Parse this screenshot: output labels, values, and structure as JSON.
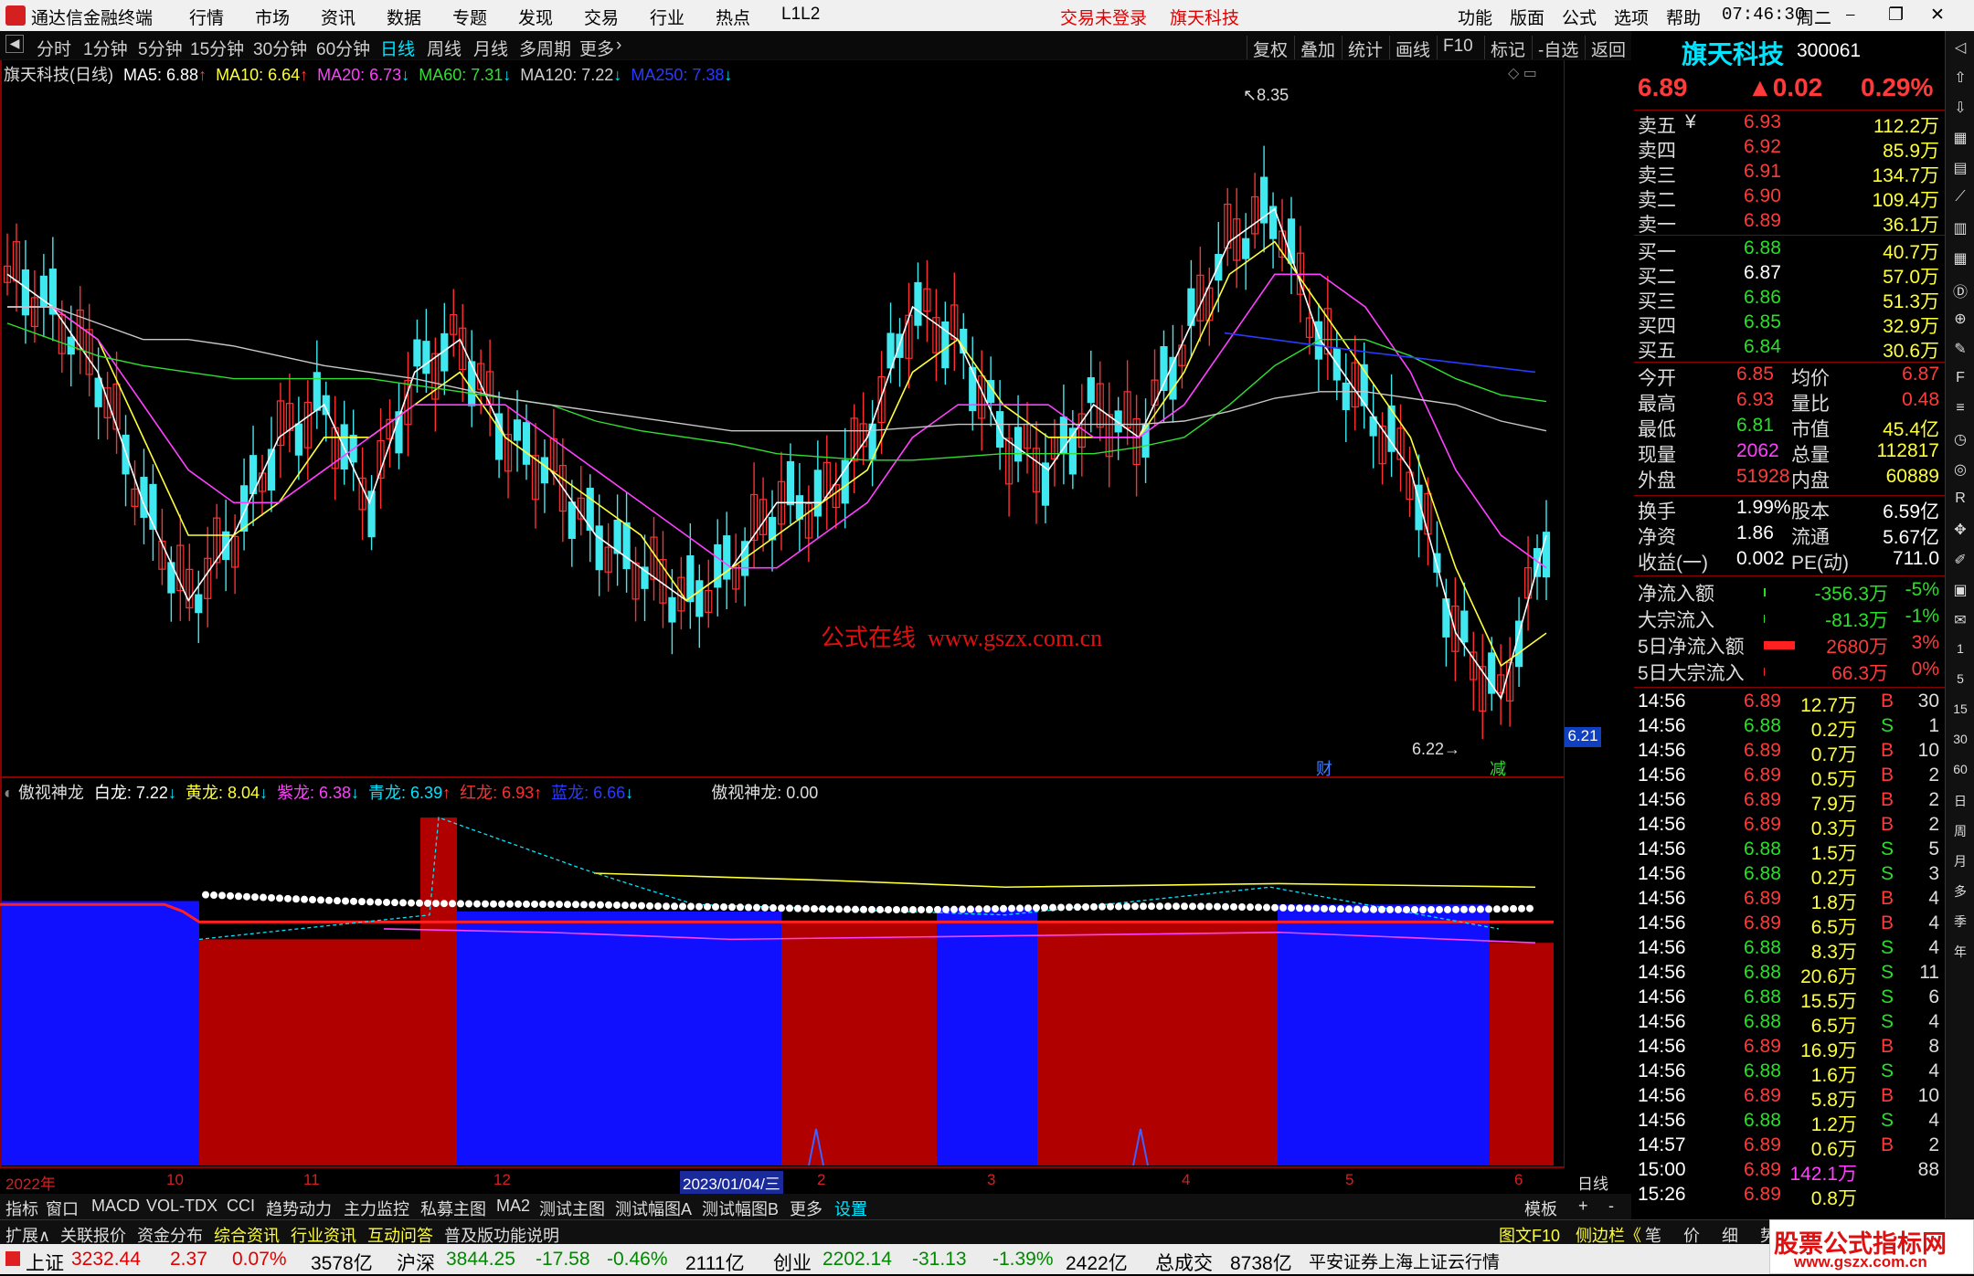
{
  "menu": {
    "app_title": "通达信金融终端",
    "items": [
      "行情",
      "市场",
      "资讯",
      "数据",
      "专题",
      "发现",
      "交易",
      "行业",
      "热点",
      "L1L2"
    ],
    "center_status": "交易未登录",
    "center_stock": "旗天科技",
    "right_items": [
      "功能",
      "版面",
      "公式",
      "选项",
      "帮助"
    ],
    "clock": "07:46:30",
    "weekday": "周二"
  },
  "periods": {
    "items": [
      "分时",
      "1分钟",
      "5分钟",
      "15分钟",
      "30分钟",
      "60分钟",
      "日线",
      "周线",
      "月线",
      "多周期",
      "更多"
    ],
    "active": "日线",
    "tools": [
      "复权",
      "叠加",
      "统计",
      "画线",
      "F10",
      "标记",
      "-自选",
      "返回"
    ]
  },
  "main_chart": {
    "title": "旗天科技(日线)",
    "ma": [
      {
        "label": "MA5: 6.88",
        "arrow": "↑",
        "color": "#ffffff"
      },
      {
        "label": "MA10: 6.64",
        "arrow": "↑",
        "color": "#ffff3a"
      },
      {
        "label": "MA20: 6.73",
        "arrow": "↓",
        "color": "#ff40ff"
      },
      {
        "label": "MA60: 7.31",
        "arrow": "↓",
        "color": "#30e030"
      },
      {
        "label": "MA120: 7.22",
        "arrow": "↓",
        "color": "#d0d0d0"
      },
      {
        "label": "MA250: 7.38",
        "arrow": "↓",
        "color": "#2a3aff"
      }
    ],
    "high_marker": "8.35",
    "low_marker": "6.22",
    "watermark": "公式在线  www.gszx.com.cn",
    "price_tag": "6.21",
    "event_tags": [
      "财",
      "减"
    ]
  },
  "sub_chart": {
    "title": "傲视神龙",
    "lines": [
      {
        "label": "白龙: 7.22",
        "arrow": "↓",
        "color": "#ffffff"
      },
      {
        "label": "黄龙: 8.04",
        "arrow": "↓",
        "color": "#ffff3a"
      },
      {
        "label": "紫龙: 6.38",
        "arrow": "↓",
        "color": "#ff40ff"
      },
      {
        "label": "青龙: 6.39",
        "arrow": "↑",
        "color": "#00e5ff"
      },
      {
        "label": "红龙: 6.93",
        "arrow": "↑",
        "color": "#ff3030"
      },
      {
        "label": "蓝龙: 6.66",
        "arrow": "↓",
        "color": "#2a3aff"
      }
    ],
    "extra": "傲视神龙: 0.00"
  },
  "chart_data": [
    {
      "type": "line",
      "title": "旗天科技(日线)",
      "ylim": [
        6.2,
        8.3
      ],
      "y_ticks": [
        "8.20",
        "8.00",
        "7.80",
        "7.60",
        "7.40",
        "7.20",
        "7.00",
        "6.80",
        "6.60",
        "6.40",
        "6.20"
      ],
      "x_labels": [
        "2022年",
        "10",
        "11",
        "12",
        "2023/01/04/三",
        "2",
        "3",
        "4",
        "5",
        "6",
        "日线"
      ],
      "series": [
        {
          "name": "MA5",
          "values": [
            7.7,
            7.6,
            7.4,
            7.0,
            6.7,
            6.9,
            7.2,
            7.3,
            7.0,
            7.4,
            7.5,
            7.2,
            7.1,
            6.9,
            6.8,
            6.7,
            6.8,
            7.0,
            7.0,
            7.2,
            7.6,
            7.5,
            7.2,
            7.1,
            7.3,
            7.2,
            7.5,
            7.8,
            7.9,
            7.5,
            7.3,
            7.1,
            6.6,
            6.4,
            6.9
          ]
        },
        {
          "name": "MA10",
          "values": [
            7.6,
            7.6,
            7.5,
            7.2,
            6.9,
            6.9,
            7.0,
            7.2,
            7.2,
            7.3,
            7.4,
            7.2,
            7.1,
            7.0,
            6.9,
            6.7,
            6.8,
            6.9,
            7.0,
            7.1,
            7.4,
            7.5,
            7.3,
            7.2,
            7.2,
            7.2,
            7.4,
            7.7,
            7.8,
            7.6,
            7.4,
            7.2,
            6.8,
            6.5,
            6.6
          ]
        },
        {
          "name": "MA20",
          "values": [
            7.6,
            7.6,
            7.5,
            7.3,
            7.1,
            7.0,
            7.0,
            7.1,
            7.2,
            7.3,
            7.3,
            7.3,
            7.2,
            7.1,
            7.0,
            6.9,
            6.8,
            6.8,
            6.9,
            7.0,
            7.2,
            7.3,
            7.3,
            7.3,
            7.2,
            7.2,
            7.3,
            7.5,
            7.7,
            7.7,
            7.6,
            7.4,
            7.1,
            6.9,
            6.8
          ]
        },
        {
          "name": "MA60",
          "values": [
            7.55,
            7.5,
            7.45,
            7.42,
            7.4,
            7.38,
            7.38,
            7.38,
            7.38,
            7.36,
            7.34,
            7.32,
            7.3,
            7.25,
            7.22,
            7.2,
            7.18,
            7.15,
            7.14,
            7.13,
            7.13,
            7.14,
            7.15,
            7.15,
            7.15,
            7.17,
            7.2,
            7.3,
            7.42,
            7.5,
            7.5,
            7.45,
            7.38,
            7.33,
            7.31
          ]
        },
        {
          "name": "MA120",
          "values": [
            7.6,
            7.6,
            7.55,
            7.5,
            7.5,
            7.48,
            7.45,
            7.42,
            7.4,
            7.38,
            7.35,
            7.32,
            7.3,
            7.28,
            7.26,
            7.24,
            7.22,
            7.22,
            7.22,
            7.22,
            7.23,
            7.24,
            7.24,
            7.24,
            7.24,
            7.24,
            7.25,
            7.28,
            7.32,
            7.34,
            7.34,
            7.32,
            7.3,
            7.25,
            7.22
          ]
        }
      ]
    },
    {
      "type": "area",
      "title": "傲视神龙",
      "ylim": [
        0,
        10.5
      ],
      "y_ticks": [
        "10.00",
        "9.00",
        "8.00",
        "7.00",
        "6.00",
        "5.00",
        "4.00",
        "3.00",
        "2.00"
      ],
      "bands": [
        {
          "color": "blue",
          "height": 7.6
        },
        {
          "color": "red",
          "height": 6.5
        },
        {
          "color": "red",
          "height": 10.0
        },
        {
          "color": "blue",
          "height": 7.3
        },
        {
          "color": "red",
          "height": 7.0
        },
        {
          "color": "blue",
          "height": 7.4
        },
        {
          "color": "red",
          "height": 7.0
        },
        {
          "color": "blue",
          "height": 7.5
        },
        {
          "color": "red",
          "height": 6.4
        }
      ]
    }
  ],
  "quote": {
    "name": "旗天科技",
    "code": "300061",
    "price": "6.89",
    "change": "▲0.02",
    "pct": "0.29%",
    "asks": [
      {
        "label": "卖五",
        "unit": "¥",
        "price": "6.93",
        "vol": "112.2万"
      },
      {
        "label": "卖四",
        "unit": "",
        "price": "6.92",
        "vol": "85.9万"
      },
      {
        "label": "卖三",
        "unit": "",
        "price": "6.91",
        "vol": "134.7万"
      },
      {
        "label": "卖二",
        "unit": "",
        "price": "6.90",
        "vol": "109.4万"
      },
      {
        "label": "卖一",
        "unit": "",
        "price": "6.89",
        "vol": "36.1万"
      }
    ],
    "bids": [
      {
        "label": "买一",
        "price": "6.88",
        "vol": "40.7万"
      },
      {
        "label": "买二",
        "price": "6.87",
        "vol": "57.0万"
      },
      {
        "label": "买三",
        "price": "6.86",
        "vol": "51.3万"
      },
      {
        "label": "买四",
        "price": "6.85",
        "vol": "32.9万"
      },
      {
        "label": "买五",
        "price": "6.84",
        "vol": "30.6万"
      }
    ],
    "stats": [
      {
        "l1": "今开",
        "v1": "6.85",
        "l2": "均价",
        "v2": "6.87"
      },
      {
        "l1": "最高",
        "v1": "6.93",
        "l2": "量比",
        "v2": "0.48"
      },
      {
        "l1": "最低",
        "v1": "6.81",
        "l2": "市值",
        "v2": "45.4亿"
      },
      {
        "l1": "现量",
        "v1": "2062",
        "l2": "总量",
        "v2": "112817"
      },
      {
        "l1": "外盘",
        "v1": "51928",
        "l2": "内盘",
        "v2": "60889"
      }
    ],
    "fund": [
      {
        "l1": "换手",
        "v1": "1.99%",
        "l2": "股本",
        "v2": "6.59亿"
      },
      {
        "l1": "净资",
        "v1": "1.86",
        "l2": "流通",
        "v2": "5.67亿"
      },
      {
        "l1": "收益(一)",
        "v1": "0.002",
        "l2": "PE(动)",
        "v2": "711.0"
      }
    ],
    "flows": [
      {
        "label": "净流入额",
        "val": "-356.3万",
        "pct": "-5%"
      },
      {
        "label": "大宗流入",
        "val": "-81.3万",
        "pct": "-1%"
      },
      {
        "label": "5日净流入额",
        "val": "2680万",
        "pct": "3%"
      },
      {
        "label": "5日大宗流入",
        "val": "66.3万",
        "pct": "0%"
      }
    ],
    "ticks": [
      {
        "t": "14:56",
        "p": "6.89",
        "v": "12.7万",
        "s": "B",
        "n": "30"
      },
      {
        "t": "14:56",
        "p": "6.88",
        "v": "0.2万",
        "s": "S",
        "n": "1"
      },
      {
        "t": "14:56",
        "p": "6.89",
        "v": "0.7万",
        "s": "B",
        "n": "10"
      },
      {
        "t": "14:56",
        "p": "6.89",
        "v": "0.5万",
        "s": "B",
        "n": "2"
      },
      {
        "t": "14:56",
        "p": "6.89",
        "v": "7.9万",
        "s": "B",
        "n": "2"
      },
      {
        "t": "14:56",
        "p": "6.89",
        "v": "0.3万",
        "s": "B",
        "n": "2"
      },
      {
        "t": "14:56",
        "p": "6.88",
        "v": "1.5万",
        "s": "S",
        "n": "5"
      },
      {
        "t": "14:56",
        "p": "6.88",
        "v": "0.2万",
        "s": "S",
        "n": "3"
      },
      {
        "t": "14:56",
        "p": "6.89",
        "v": "1.8万",
        "s": "B",
        "n": "4"
      },
      {
        "t": "14:56",
        "p": "6.89",
        "v": "6.5万",
        "s": "B",
        "n": "4"
      },
      {
        "t": "14:56",
        "p": "6.88",
        "v": "8.3万",
        "s": "S",
        "n": "4"
      },
      {
        "t": "14:56",
        "p": "6.88",
        "v": "20.6万",
        "s": "S",
        "n": "11"
      },
      {
        "t": "14:56",
        "p": "6.88",
        "v": "15.5万",
        "s": "S",
        "n": "6"
      },
      {
        "t": "14:56",
        "p": "6.88",
        "v": "6.5万",
        "s": "S",
        "n": "4"
      },
      {
        "t": "14:56",
        "p": "6.89",
        "v": "16.9万",
        "s": "B",
        "n": "8"
      },
      {
        "t": "14:56",
        "p": "6.88",
        "v": "1.6万",
        "s": "S",
        "n": "4"
      },
      {
        "t": "14:56",
        "p": "6.89",
        "v": "5.8万",
        "s": "B",
        "n": "10"
      },
      {
        "t": "14:56",
        "p": "6.88",
        "v": "1.2万",
        "s": "S",
        "n": "4"
      },
      {
        "t": "14:57",
        "p": "6.89",
        "v": "0.6万",
        "s": "B",
        "n": "2"
      },
      {
        "t": "15:00",
        "p": "6.89",
        "v": "142.1万",
        "s": "",
        "n": "88"
      },
      {
        "t": "15:26",
        "p": "6.89",
        "v": "0.8万",
        "s": "",
        "n": ""
      }
    ],
    "bottom_tabs": [
      "笔",
      "价",
      "细",
      "势"
    ]
  },
  "bottom_tabs": [
    "指标",
    "窗口",
    "MACD",
    "VOL-TDX",
    "CCI",
    "趋势动力",
    "主力监控",
    "私募主图",
    "MA2",
    "测试主图",
    "测试幅图A",
    "测试幅图B",
    "更多",
    "设置"
  ],
  "bottom_right": [
    "模板",
    "+",
    "-"
  ],
  "info_tabs": [
    "扩展∧",
    "关联报价",
    "资金分布",
    "综合资讯",
    "行业资讯",
    "互动问答",
    "普及版功能说明"
  ],
  "info_right": [
    "图文F10",
    "侧边栏《"
  ],
  "status": {
    "items": [
      {
        "name": "上证",
        "val": "3232.44",
        "chg": "2.37",
        "pct": "0.07%",
        "amt": "3578亿"
      },
      {
        "name": "沪深",
        "val": "3844.25",
        "chg": "-17.58",
        "pct": "-0.46%",
        "amt": "2111亿"
      },
      {
        "name": "创业",
        "val": "2202.14",
        "chg": "-31.13",
        "pct": "-1.39%",
        "amt": "2422亿"
      }
    ],
    "total_label": "总成交",
    "total_val": "8738亿",
    "source": "平安证券上海上证云行情"
  },
  "corner_logo": {
    "name": "股票公式指标网",
    "url": "www.gszx.com.cn"
  },
  "colors": {
    "up": "#ff3a3a",
    "down": "#29e029",
    "accent": "#00e5ff",
    "panel_border": "#8b0000"
  }
}
